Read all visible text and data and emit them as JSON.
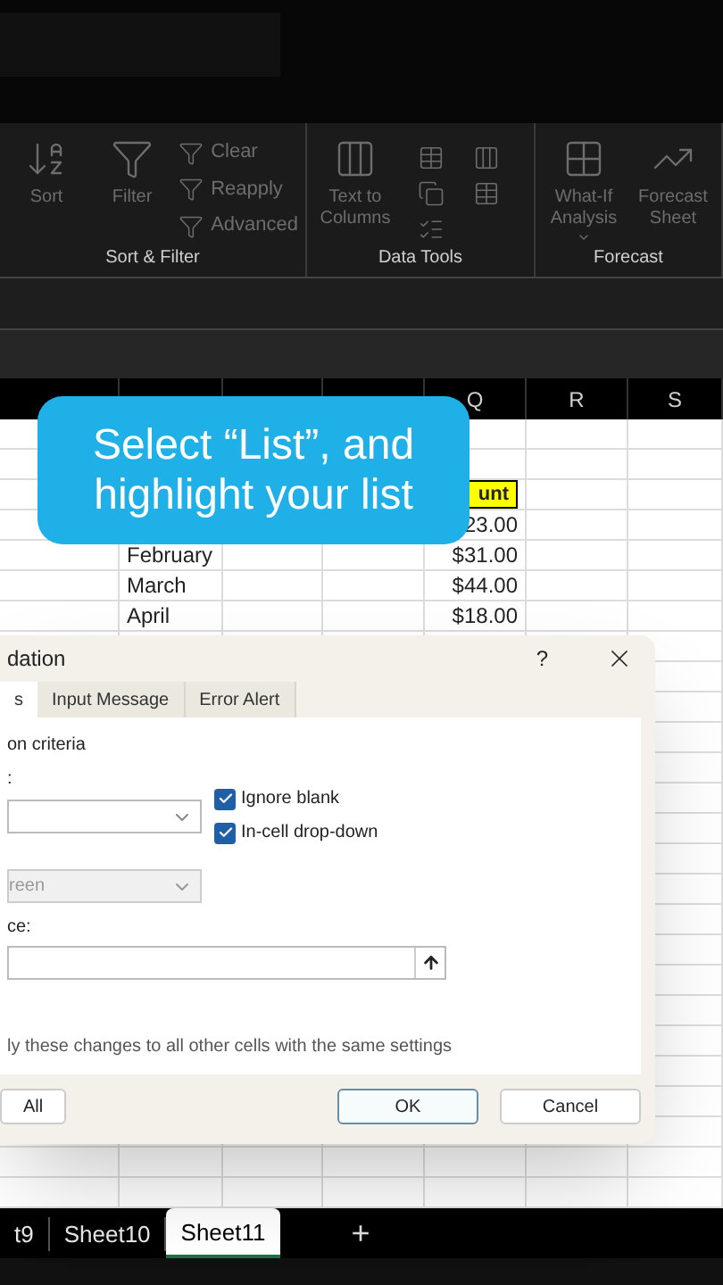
{
  "ribbon": {
    "disabled": true,
    "groups": [
      {
        "label": "Sort & Filter",
        "large": [
          {
            "label": "Sort",
            "kind": "sort"
          },
          {
            "label": "Filter",
            "kind": "filter"
          }
        ],
        "small": [
          "Clear",
          "Reapply",
          "Advanced"
        ]
      },
      {
        "label": "Data Tools",
        "large": [
          {
            "label": "Text to Columns",
            "kind": "columns"
          }
        ]
      },
      {
        "label": "Forecast",
        "large": [
          {
            "label": "What-If Analysis",
            "kind": "whatif",
            "has_menu": true
          },
          {
            "label": "Forecast Sheet",
            "kind": "forecast",
            "has_menu": false
          }
        ]
      }
    ]
  },
  "sheet": {
    "column_headers": [
      "Q",
      "R",
      "S"
    ],
    "rows": [
      {},
      {},
      {
        "amount": "unt",
        "amount_highlight": true
      },
      {
        "amount": "23.00",
        "amount_highlight": false
      },
      {
        "month": "February",
        "amount": "$31.00",
        "amount_highlight": false
      },
      {
        "month": "March",
        "amount": "$44.00",
        "amount_highlight": false
      },
      {
        "month": "April",
        "amount": "$18.00",
        "amount_highlight": false
      }
    ]
  },
  "caption": "Select “List”, and highlight your list",
  "dialog": {
    "title": "dation",
    "help": "?",
    "tabs": [
      {
        "label": "s",
        "selected": true
      },
      {
        "label": "Input Message",
        "selected": false
      },
      {
        "label": "Error Alert",
        "selected": false
      }
    ],
    "section": "on criteria",
    "allow_label": ":",
    "checkboxes": [
      {
        "label": "Ignore blank",
        "checked": true
      },
      {
        "label": "In-cell drop-down",
        "checked": true
      }
    ],
    "data_value": "reen",
    "source_label": "ce:",
    "apply_text": "ly these changes to all other cells with the same settings",
    "buttons": [
      {
        "label": "All",
        "kind": "secondary"
      },
      {
        "label": "OK",
        "kind": "default"
      },
      {
        "label": "Cancel",
        "kind": "secondary"
      }
    ]
  },
  "sheet_tabs": [
    {
      "label": "t9",
      "selected": false
    },
    {
      "label": "Sheet10",
      "selected": false
    },
    {
      "label": "Sheet11",
      "selected": true
    }
  ],
  "add_sheet": "+"
}
